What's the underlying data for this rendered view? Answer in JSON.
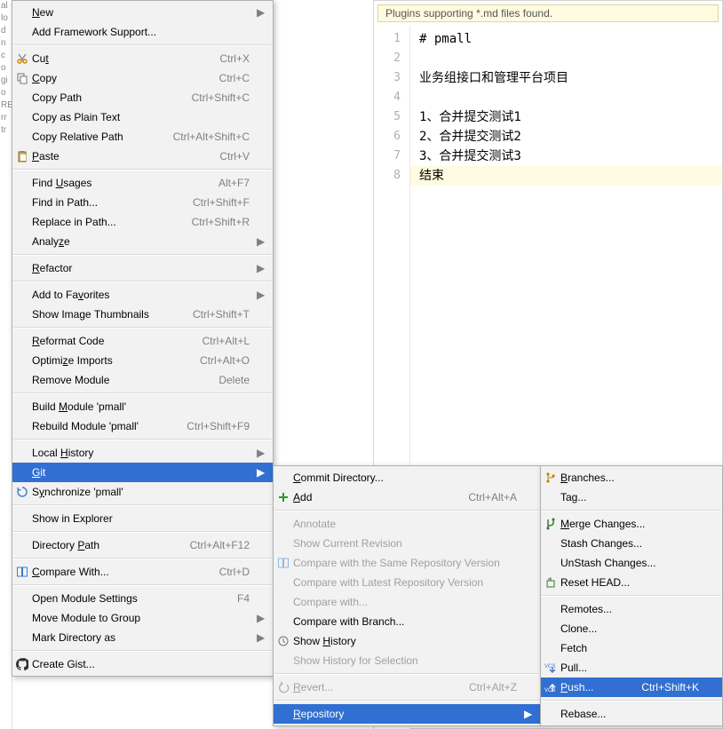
{
  "left_strip": [
    "al",
    "lo",
    "d",
    "n",
    "c",
    "o",
    "gi",
    "o",
    "RE",
    "rr",
    "",
    "tr"
  ],
  "hint_text": "Plugins supporting *.md files found.",
  "editor_lines": [
    "# pmall",
    "",
    "业务组接口和管理平台项目",
    "",
    "1、合并提交测试1",
    "2、合并提交测试2",
    "3、合并提交测试3",
    "结束"
  ],
  "editor_highlight_line": 8,
  "menu_main": [
    {
      "type": "item",
      "label": "New",
      "mn": "N",
      "sub": true
    },
    {
      "type": "item",
      "label": "Add Framework Support..."
    },
    {
      "type": "sep"
    },
    {
      "type": "item",
      "label": "Cut",
      "mn": "t",
      "shortcut": "Ctrl+X",
      "icon": "cut"
    },
    {
      "type": "item",
      "label": "Copy",
      "mn": "C",
      "shortcut": "Ctrl+C",
      "icon": "copy"
    },
    {
      "type": "item",
      "label": "Copy Path",
      "shortcut": "Ctrl+Shift+C"
    },
    {
      "type": "item",
      "label": "Copy as Plain Text"
    },
    {
      "type": "item",
      "label": "Copy Relative Path",
      "shortcut": "Ctrl+Alt+Shift+C"
    },
    {
      "type": "item",
      "label": "Paste",
      "mn": "P",
      "shortcut": "Ctrl+V",
      "icon": "paste"
    },
    {
      "type": "sep"
    },
    {
      "type": "item",
      "label": "Find Usages",
      "mn": "U",
      "shortcut": "Alt+F7"
    },
    {
      "type": "item",
      "label": "Find in Path...",
      "shortcut": "Ctrl+Shift+F"
    },
    {
      "type": "item",
      "label": "Replace in Path...",
      "shortcut": "Ctrl+Shift+R"
    },
    {
      "type": "item",
      "label": "Analyze",
      "mn": "z",
      "sub": true
    },
    {
      "type": "sep"
    },
    {
      "type": "item",
      "label": "Refactor",
      "mn": "R",
      "sub": true
    },
    {
      "type": "sep"
    },
    {
      "type": "item",
      "label": "Add to Favorites",
      "mn": "v",
      "sub": true
    },
    {
      "type": "item",
      "label": "Show Image Thumbnails",
      "shortcut": "Ctrl+Shift+T"
    },
    {
      "type": "sep"
    },
    {
      "type": "item",
      "label": "Reformat Code",
      "mn": "R",
      "shortcut": "Ctrl+Alt+L"
    },
    {
      "type": "item",
      "label": "Optimize Imports",
      "mn": "z",
      "shortcut": "Ctrl+Alt+O"
    },
    {
      "type": "item",
      "label": "Remove Module",
      "shortcut": "Delete"
    },
    {
      "type": "sep"
    },
    {
      "type": "item",
      "label": "Build Module 'pmall'",
      "mn": "M"
    },
    {
      "type": "item",
      "label": "Rebuild Module 'pmall'",
      "shortcut": "Ctrl+Shift+F9"
    },
    {
      "type": "sep"
    },
    {
      "type": "item",
      "label": "Local History",
      "mn": "H",
      "sub": true
    },
    {
      "type": "item",
      "label": "Git",
      "mn": "G",
      "sub": true,
      "sel": true
    },
    {
      "type": "item",
      "label": "Synchronize 'pmall'",
      "mn": "y",
      "icon": "sync"
    },
    {
      "type": "sep"
    },
    {
      "type": "item",
      "label": "Show in Explorer"
    },
    {
      "type": "sep"
    },
    {
      "type": "item",
      "label": "Directory Path",
      "mn": "P",
      "shortcut": "Ctrl+Alt+F12"
    },
    {
      "type": "sep"
    },
    {
      "type": "item",
      "label": "Compare With...",
      "mn": "C",
      "shortcut": "Ctrl+D",
      "icon": "compare"
    },
    {
      "type": "sep"
    },
    {
      "type": "item",
      "label": "Open Module Settings",
      "shortcut": "F4"
    },
    {
      "type": "item",
      "label": "Move Module to Group",
      "sub": true
    },
    {
      "type": "item",
      "label": "Mark Directory as",
      "sub": true
    },
    {
      "type": "sep"
    },
    {
      "type": "item",
      "label": "Create Gist...",
      "icon": "github"
    }
  ],
  "menu_git": [
    {
      "type": "item",
      "label": "Commit Directory...",
      "mn": "C"
    },
    {
      "type": "item",
      "label": "Add",
      "mn": "A",
      "shortcut": "Ctrl+Alt+A",
      "icon": "add"
    },
    {
      "type": "sep"
    },
    {
      "type": "item",
      "label": "Annotate",
      "disabled": true
    },
    {
      "type": "item",
      "label": "Show Current Revision",
      "disabled": true
    },
    {
      "type": "item",
      "label": "Compare with the Same Repository Version",
      "disabled": true,
      "icon": "compare"
    },
    {
      "type": "item",
      "label": "Compare with Latest Repository Version",
      "disabled": true
    },
    {
      "type": "item",
      "label": "Compare with...",
      "disabled": true
    },
    {
      "type": "item",
      "label": "Compare with Branch..."
    },
    {
      "type": "item",
      "label": "Show History",
      "mn": "H",
      "icon": "history"
    },
    {
      "type": "item",
      "label": "Show History for Selection",
      "disabled": true
    },
    {
      "type": "sep"
    },
    {
      "type": "item",
      "label": "Revert...",
      "mn": "R",
      "shortcut": "Ctrl+Alt+Z",
      "disabled": true,
      "icon": "revert"
    },
    {
      "type": "sep"
    },
    {
      "type": "item",
      "label": "Repository",
      "mn": "R",
      "sub": true,
      "sel": true
    }
  ],
  "menu_repo": [
    {
      "type": "item",
      "label": "Branches...",
      "mn": "B",
      "icon": "branch"
    },
    {
      "type": "item",
      "label": "Tag..."
    },
    {
      "type": "sep"
    },
    {
      "type": "item",
      "label": "Merge Changes...",
      "mn": "M",
      "icon": "merge"
    },
    {
      "type": "item",
      "label": "Stash Changes..."
    },
    {
      "type": "item",
      "label": "UnStash Changes..."
    },
    {
      "type": "item",
      "label": "Reset HEAD...",
      "icon": "reset"
    },
    {
      "type": "sep"
    },
    {
      "type": "item",
      "label": "Remotes..."
    },
    {
      "type": "item",
      "label": "Clone..."
    },
    {
      "type": "item",
      "label": "Fetch"
    },
    {
      "type": "item",
      "label": "Pull...",
      "icon": "pull"
    },
    {
      "type": "item",
      "label": "Push...",
      "mn": "P",
      "shortcut": "Ctrl+Shift+K",
      "sel": true,
      "icon": "push"
    },
    {
      "type": "sep"
    },
    {
      "type": "item",
      "label": "Rebase..."
    }
  ]
}
